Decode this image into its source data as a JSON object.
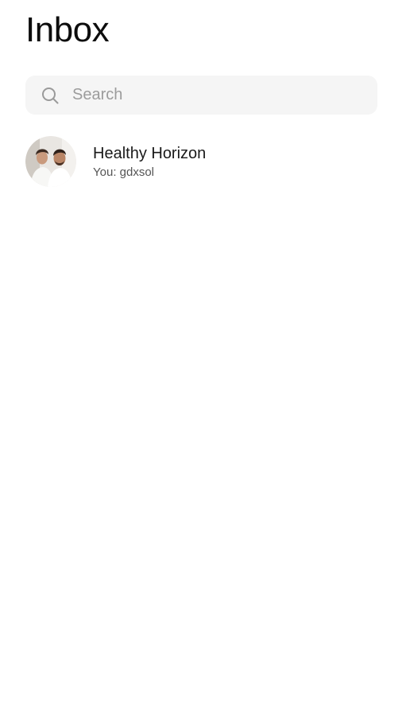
{
  "header": {
    "title": "Inbox"
  },
  "search": {
    "placeholder": "Search",
    "icon": "search-icon"
  },
  "conversations": [
    {
      "name": "Healthy Horizon",
      "preview": "You: gdxsol",
      "avatar_icon": "avatar"
    }
  ]
}
